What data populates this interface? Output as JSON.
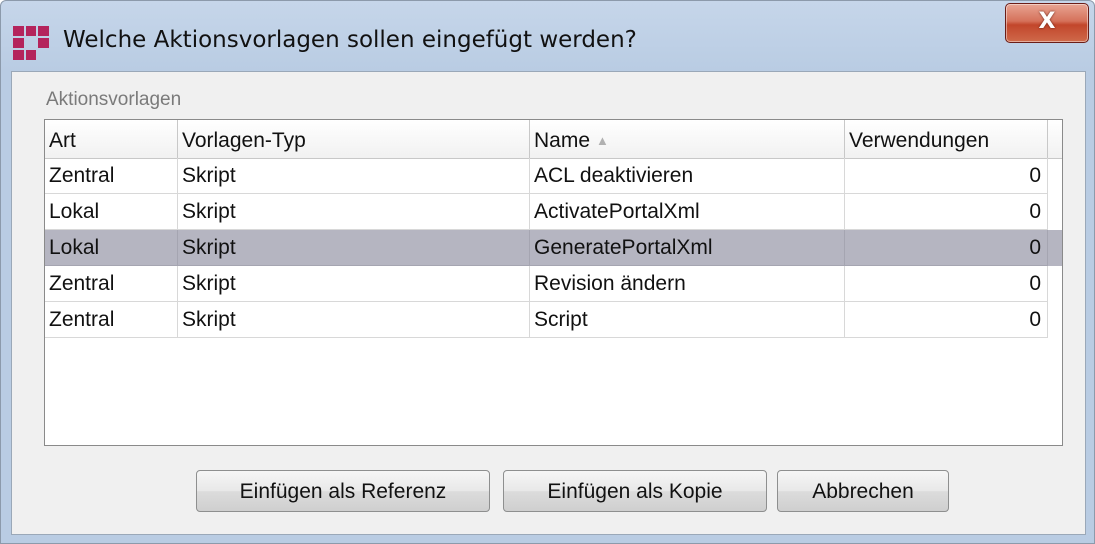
{
  "window": {
    "title": "Welche Aktionsvorlagen sollen eingefügt werden?",
    "close_label": "X"
  },
  "group": {
    "label": "Aktionsvorlagen"
  },
  "table": {
    "columns": [
      "Art",
      "Vorlagen-Typ",
      "Name",
      "Verwendungen"
    ],
    "sort_indicator": "▲",
    "rows": [
      [
        "Zentral",
        "Skript",
        "ACL deaktivieren",
        "0"
      ],
      [
        "Lokal",
        "Skript",
        "ActivatePortalXml",
        "0"
      ],
      [
        "Lokal",
        "Skript",
        "GeneratePortalXml",
        "0"
      ],
      [
        "Zentral",
        "Skript",
        "Revision ändern",
        "0"
      ],
      [
        "Zentral",
        "Skript",
        "Script",
        "0"
      ]
    ],
    "selected_row_index": 2
  },
  "buttons": {
    "insert_reference": "Einfügen als Referenz",
    "insert_copy": "Einfügen als Kopie",
    "cancel": "Abbrechen"
  },
  "colors": {
    "titlebar": "#c6d6ea",
    "close_button": "#c2462b",
    "selected_row": "#b5b5c1",
    "app_icon": "#b4245c"
  }
}
